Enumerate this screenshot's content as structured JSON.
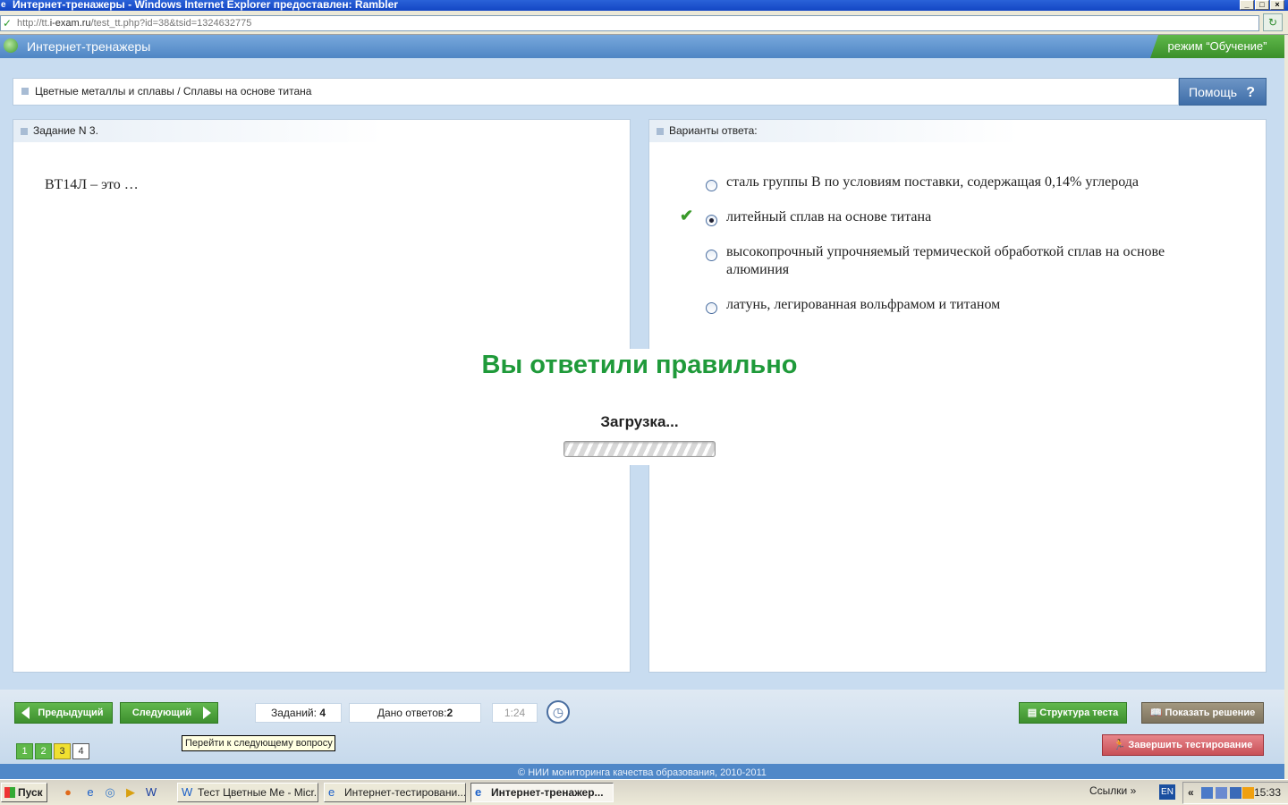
{
  "window": {
    "title": "Интернет-тренажеры - Windows Internet Explorer предоставлен: Rambler",
    "controls": [
      "_",
      "□",
      "×"
    ]
  },
  "address": {
    "url_prefix": "http://tt.",
    "url_host": "i-exam.ru",
    "url_path": "/test_tt.php?id=38&tsid=1324632775"
  },
  "app": {
    "title": "Интернет-тренажеры",
    "mode": "режим “Обучение”"
  },
  "breadcrumb": "Цветные металлы и сплавы / Сплавы на основе титана",
  "help": {
    "label": "Помощь",
    "icon": "?"
  },
  "task": {
    "header": "Задание N 3.",
    "question": "ВТ14Л – это …"
  },
  "answers": {
    "header": "Варианты ответа:",
    "options": [
      {
        "text": "сталь группы В по условиям поставки, содержащая 0,14% углерода",
        "selected": false,
        "correct_mark": false
      },
      {
        "text": "литейный сплав на основе титана",
        "selected": true,
        "correct_mark": true
      },
      {
        "text": "высокопрочный упрочняемый термической обработкой сплав на основе алюминия",
        "selected": false,
        "correct_mark": false
      },
      {
        "text": "латунь, легированная вольфрамом и титаном",
        "selected": false,
        "correct_mark": false
      }
    ]
  },
  "feedback": {
    "result": "Вы ответили правильно",
    "loading": "Загрузка..."
  },
  "nav": {
    "prev": "Предыдущий",
    "next": "Следующий",
    "tasks_label": "Заданий:",
    "tasks_count": "4",
    "answered_label": "Дано ответов:",
    "answered_count": "2",
    "timer": "1:24",
    "tooltip": "Перейти к следующему вопросу",
    "pages": [
      "1",
      "2",
      "3",
      "4"
    ],
    "structure": "Структура теста",
    "show_solution": "Показать решение",
    "finish": "Завершить тестирование"
  },
  "footer": "© НИИ мониторинга качества образования, 2010-2011",
  "taskbar": {
    "start": "Пуск",
    "tasks": [
      "Тест Цветные Ме - Micr...",
      "Интернет-тестировани...",
      "Интернет-тренажер..."
    ],
    "links": "Ссылки",
    "lang": "EN",
    "time": "15:33"
  },
  "colors": {
    "accent_green": "#3d8f2e",
    "header_blue": "#4f86c4",
    "correct_text": "#1f9a3a",
    "finish_red": "#c85057"
  }
}
